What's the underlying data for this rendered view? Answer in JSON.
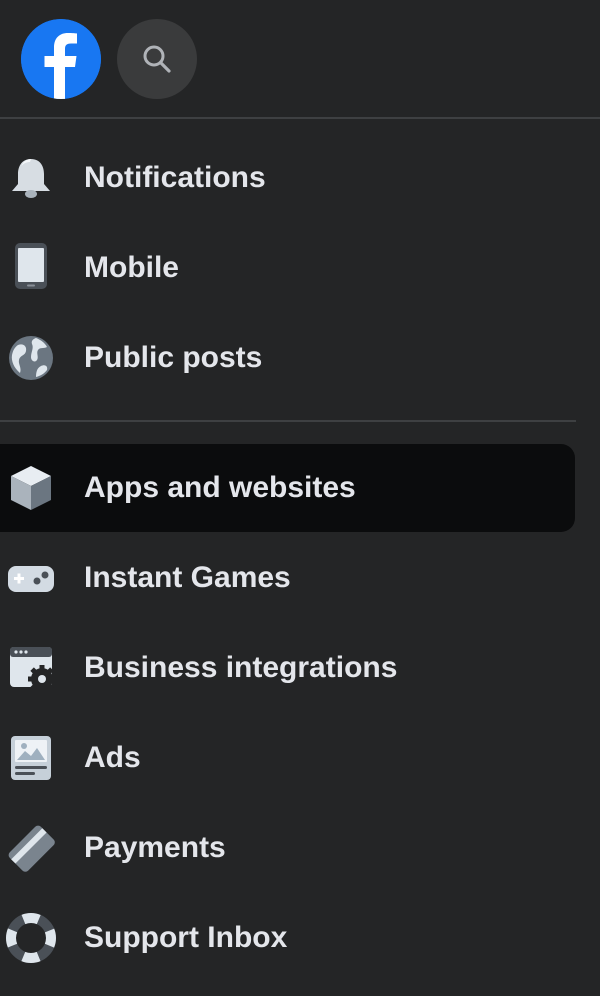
{
  "header": {
    "logo_icon": "facebook-logo-icon",
    "search_icon": "search-icon",
    "brand_color": "#1877f2"
  },
  "menu": {
    "group1": [
      {
        "label": "Notifications",
        "icon": "bell-icon"
      },
      {
        "label": "Mobile",
        "icon": "phone-icon"
      },
      {
        "label": "Public posts",
        "icon": "globe-icon"
      }
    ],
    "group2": [
      {
        "label": "Apps and websites",
        "icon": "cube-icon",
        "active": true
      },
      {
        "label": "Instant Games",
        "icon": "gamepad-icon"
      },
      {
        "label": "Business integrations",
        "icon": "browser-gear-icon"
      },
      {
        "label": "Ads",
        "icon": "ad-monitor-icon"
      },
      {
        "label": "Payments",
        "icon": "card-icon"
      },
      {
        "label": "Support Inbox",
        "icon": "lifebuoy-icon"
      }
    ]
  },
  "colors": {
    "background": "#242526",
    "active_background": "#0b0c0d",
    "text": "#e4e6eb",
    "divider": "#3e4042"
  }
}
